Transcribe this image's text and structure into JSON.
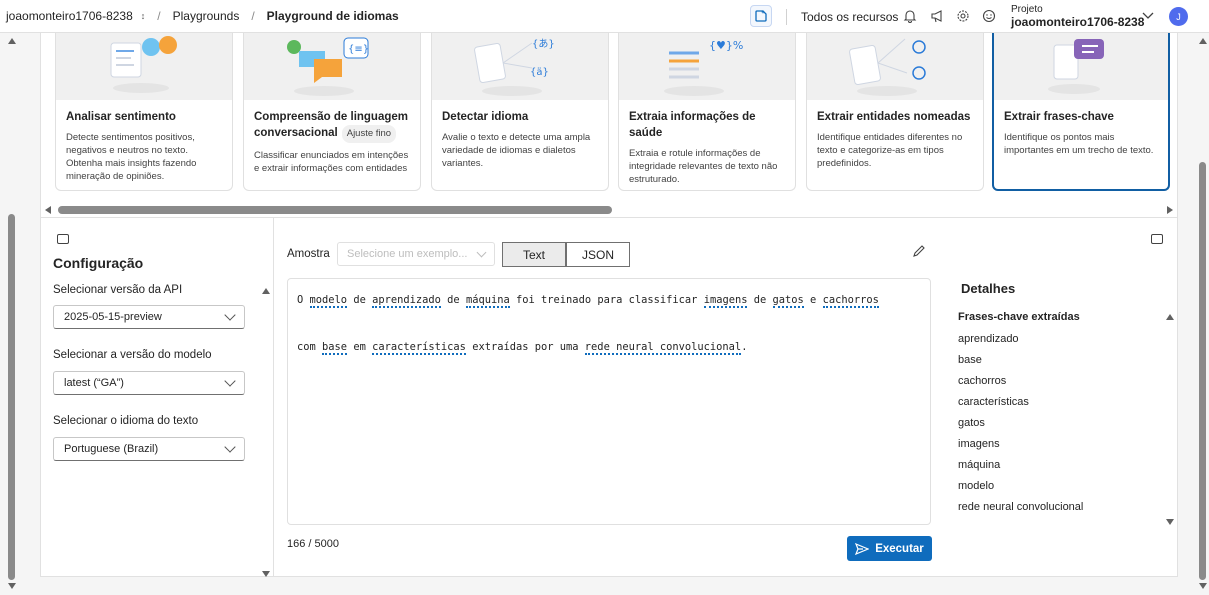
{
  "topbar": {
    "breadcrumb": [
      "joaomonteiro1706-8238",
      "Playgrounds",
      "Playground de idiomas"
    ],
    "all_resources": "Todos os recursos",
    "project_label": "Projeto",
    "project_name": "joaomonteiro1706-8238",
    "avatar_initial": "J",
    "icons": [
      "copilot-icon",
      "bell-icon",
      "megaphone-icon",
      "gear-icon",
      "smiley-icon",
      "chevron-down-icon"
    ]
  },
  "cards": [
    {
      "title": "Analisar sentimento",
      "badge": "",
      "desc": "Detecte sentimentos positivos, negativos e neutros no texto. Obtenha mais insights fazendo mineração de opiniões."
    },
    {
      "title": "Compreensão de linguagem conversacional",
      "badge": "Ajuste fino",
      "desc": "Classificar enunciados em intenções e extrair informações com entidades"
    },
    {
      "title": "Detectar idioma",
      "badge": "",
      "desc": "Avalie o texto e detecte uma ampla variedade de idiomas e dialetos variantes."
    },
    {
      "title": "Extraia informações de saúde",
      "badge": "",
      "desc": "Extraia e rotule informações de integridade relevantes de texto não estruturado."
    },
    {
      "title": "Extrair entidades nomeadas",
      "badge": "",
      "desc": "Identifique entidades diferentes no texto e categorize-as em tipos predefinidos."
    },
    {
      "title": "Extrair frases-chave",
      "badge": "",
      "desc": "Identifique os pontos mais importantes em um trecho de texto."
    }
  ],
  "config": {
    "title": "Configuração",
    "api_label": "Selecionar versão da API",
    "api_value": "2025-05-15-preview",
    "model_label": "Selecionar a versão do modelo",
    "model_value": "latest (“GA”)",
    "lang_label": "Selecionar o idioma do texto",
    "lang_value": "Portuguese (Brazil)"
  },
  "editor": {
    "sample_label": "Amostra",
    "sample_placeholder": "Selecione um exemplo...",
    "tab_text": "Text",
    "tab_json": "JSON",
    "counter": "166 / 5000",
    "run_label": "Executar"
  },
  "details": {
    "title": "Detalhes",
    "subtitle": "Frases-chave extraídas",
    "phrases": [
      "aprendizado",
      "base",
      "cachorros",
      "características",
      "gatos",
      "imagens",
      "máquina",
      "modelo",
      "rede neural convolucional"
    ]
  },
  "colors": {
    "accent": "#0f6cbd",
    "selected_border": "#115ea3"
  }
}
